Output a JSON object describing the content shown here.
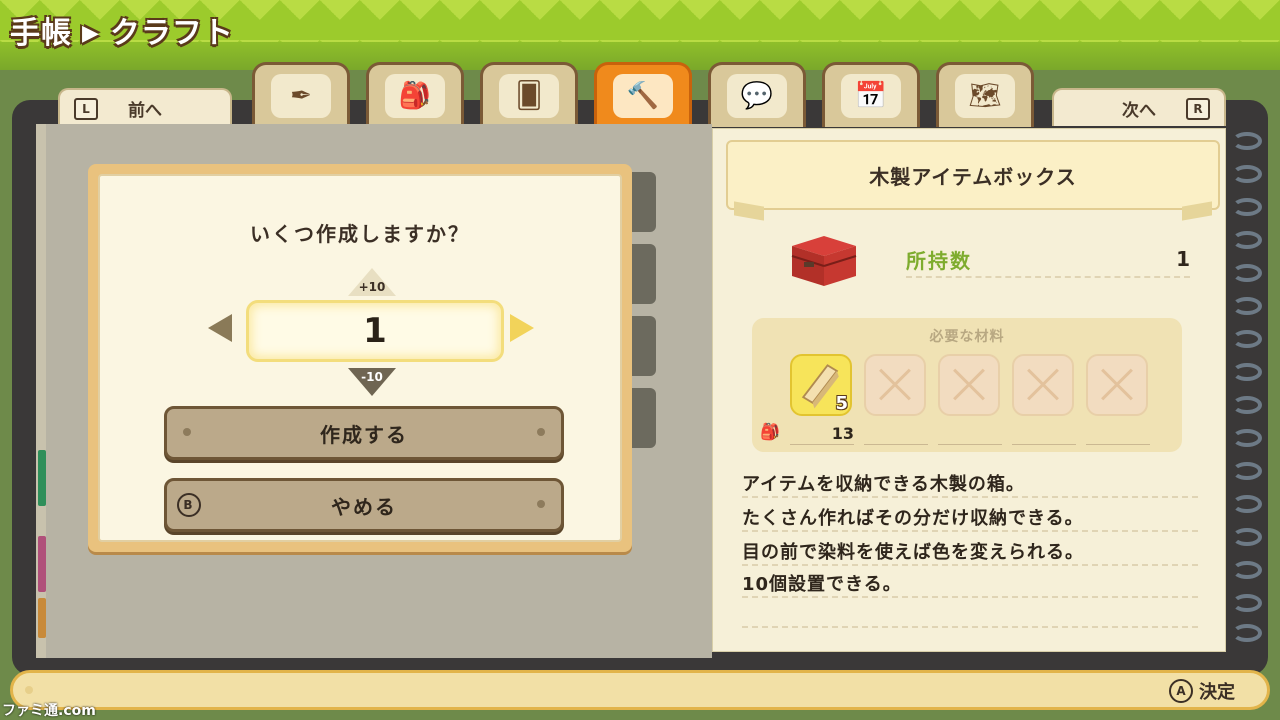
{
  "header": {
    "title_part1": "手帳",
    "separator": "▶",
    "title_part2": "クラフト"
  },
  "nav": {
    "prev_label": "前へ",
    "prev_key": "L",
    "next_label": "次へ",
    "next_key": "R"
  },
  "tabs": [
    {
      "icon": "pen-icon",
      "glyph": "✒",
      "active": false
    },
    {
      "icon": "backpack-icon",
      "glyph": "🎒",
      "active": false
    },
    {
      "icon": "cards-icon",
      "glyph": "🂠",
      "active": false
    },
    {
      "icon": "craft-hammer-icon",
      "glyph": "🔨",
      "active": true
    },
    {
      "icon": "heart-chat-icon",
      "glyph": "💬",
      "active": false
    },
    {
      "icon": "calendar-icon",
      "glyph": "📅",
      "active": false
    },
    {
      "icon": "map-icon",
      "glyph": "🗺",
      "active": false
    }
  ],
  "dialog": {
    "question": "いくつ作成しますか？",
    "quantity": "1",
    "step_up": "+10",
    "step_down": "-10",
    "create_label": "作成する",
    "cancel_label": "やめる",
    "cancel_key": "B"
  },
  "item": {
    "name": "木製アイテムボックス",
    "owned_label": "所持数",
    "owned_count": "1",
    "materials_title": "必要な材料",
    "materials": [
      {
        "name": "wood-plank",
        "required": "5",
        "have": "13"
      },
      {
        "name": "",
        "required": "",
        "have": ""
      },
      {
        "name": "",
        "required": "",
        "have": ""
      },
      {
        "name": "",
        "required": "",
        "have": ""
      },
      {
        "name": "",
        "required": "",
        "have": ""
      }
    ],
    "description": [
      "アイテムを収納できる木製の箱。",
      "たくさん作ればその分だけ収納できる。",
      "目の前で染料を使えば色を変えられる。",
      "10個設置できる。"
    ]
  },
  "footer": {
    "confirm_key": "A",
    "confirm_label": "決定"
  },
  "watermark": "ファミ通.com",
  "colors": {
    "accent_orange": "#f08a1c",
    "owned_green": "#7eac2e",
    "selected_yellow": "#f7e45a"
  }
}
